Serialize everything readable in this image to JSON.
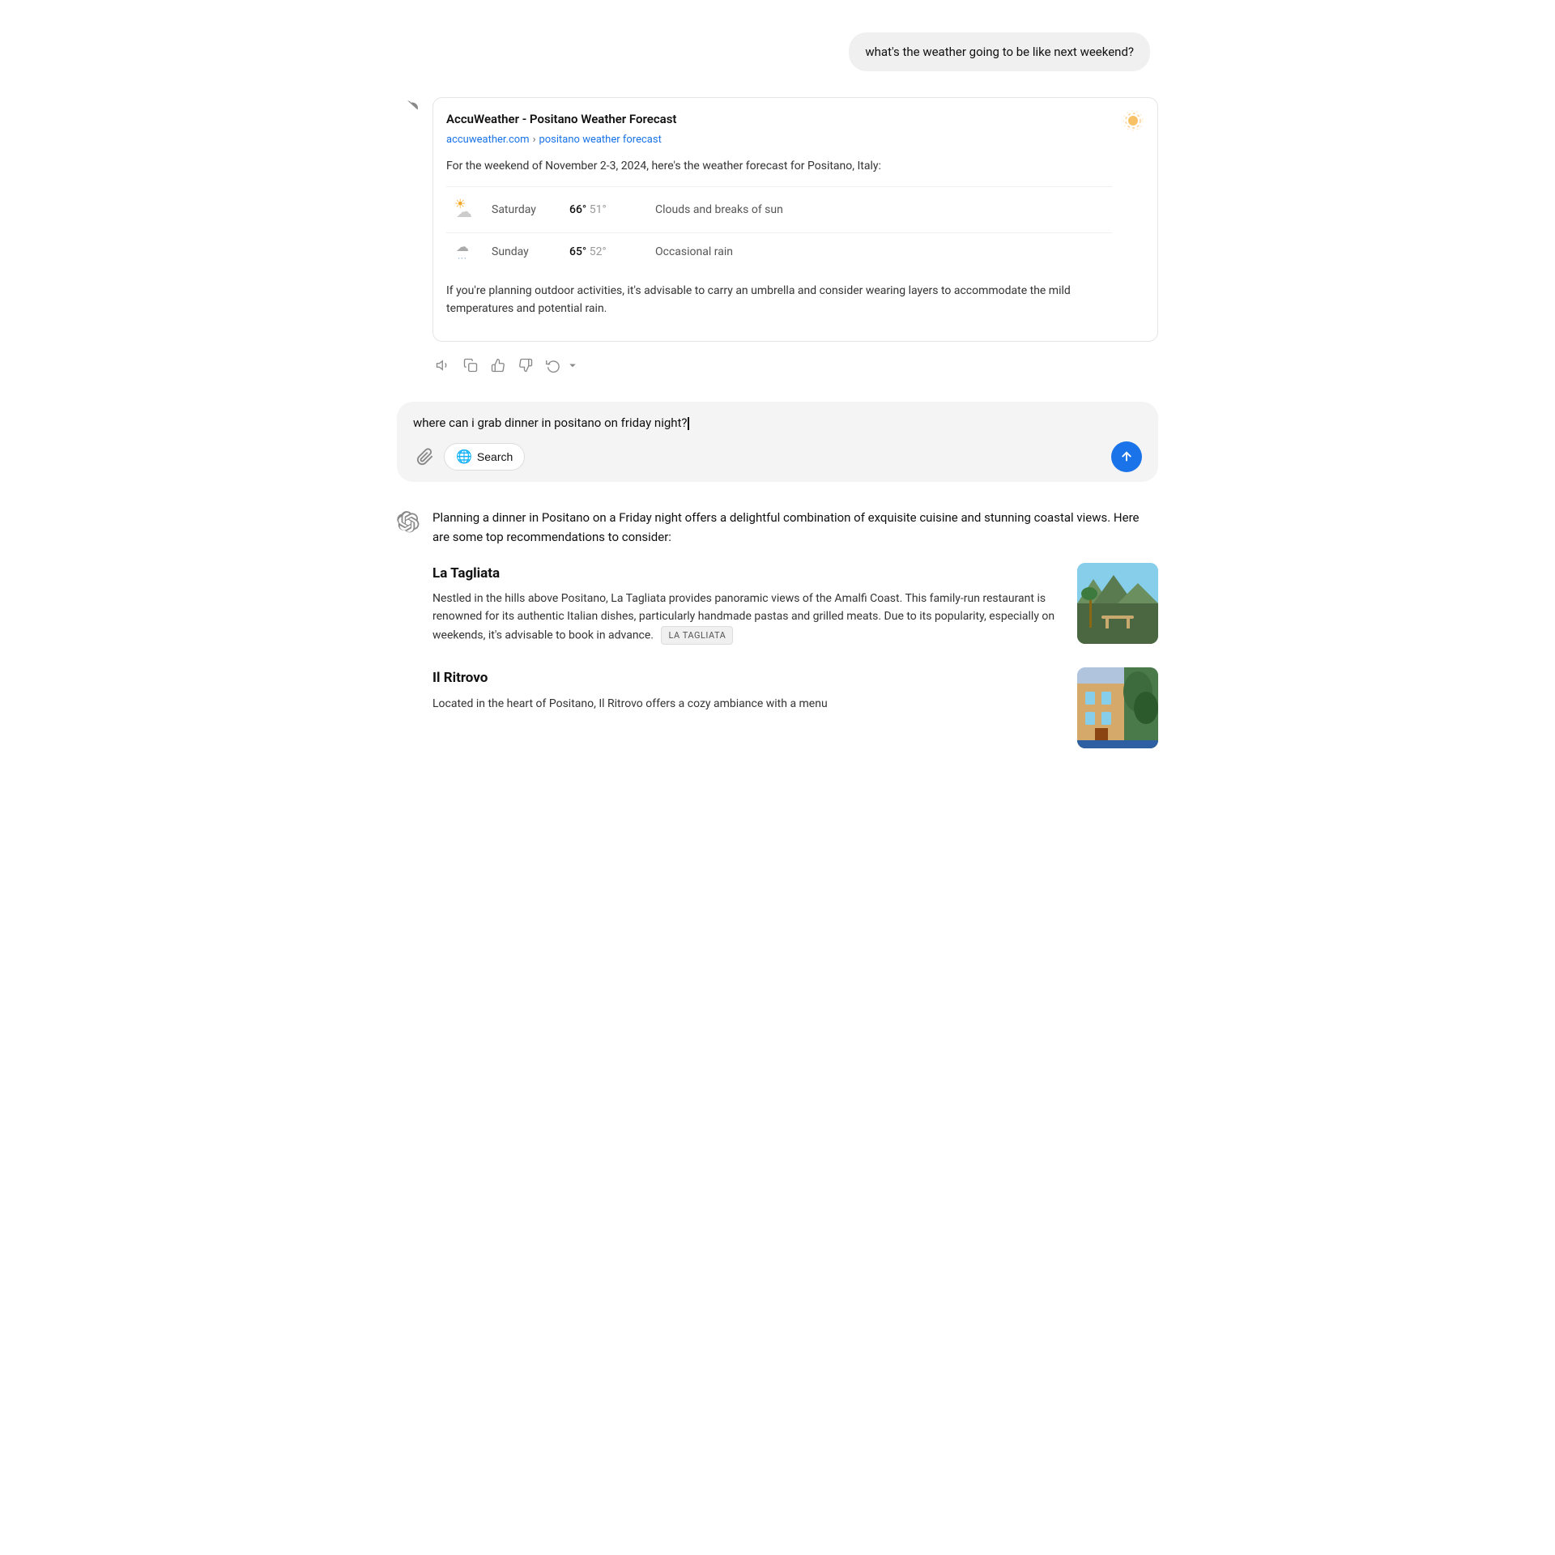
{
  "userQuery1": {
    "text": "what's the weather going to be like next weekend?"
  },
  "weatherResponse": {
    "source": {
      "title": "AccuWeather - Positano Weather Forecast",
      "urlBase": "accuweather.com",
      "urlPath": "positano weather forecast",
      "intro": "For the weekend of November 2-3, 2024, here's the weather forecast for Positano, Italy:",
      "days": [
        {
          "icon": "partly-cloudy",
          "day": "Saturday",
          "high": "66°",
          "low": "51°",
          "desc": "Clouds and breaks of sun"
        },
        {
          "icon": "rainy",
          "day": "Sunday",
          "high": "65°",
          "low": "52°",
          "desc": "Occasional rain"
        }
      ],
      "advice": "If you're planning outdoor activities, it's advisable to carry an umbrella and consider wearing layers to accommodate the mild temperatures and potential rain."
    }
  },
  "userQuery2": {
    "text": "where can i grab dinner in positano on friday night?"
  },
  "dinnerResponse": {
    "intro": "Planning a dinner in Positano on a Friday night offers a delightful combination of exquisite cuisine and stunning coastal views. Here are some top recommendations to consider:",
    "restaurants": [
      {
        "name": "La Tagliata",
        "desc": "Nestled in the hills above Positano, La Tagliata provides panoramic views of the Amalfi Coast. This family-run restaurant is renowned for its authentic Italian dishes, particularly handmade pastas and grilled meats. Due to its popularity, especially on weekends, it's advisable to book in advance.",
        "tag": "LA TAGLIATA"
      },
      {
        "name": "Il Ritrovo",
        "desc": "Located in the heart of Positano, Il Ritrovo offers a cozy ambiance with a menu",
        "tag": ""
      }
    ]
  },
  "inputBox": {
    "text": "where can i grab dinner in positano on friday night?",
    "searchLabel": "Search",
    "attachTitle": "Attach file"
  },
  "actions": {
    "speak": "Read aloud",
    "copy": "Copy",
    "thumbsUp": "Good response",
    "thumbsDown": "Bad response",
    "regenerate": "Regenerate"
  }
}
